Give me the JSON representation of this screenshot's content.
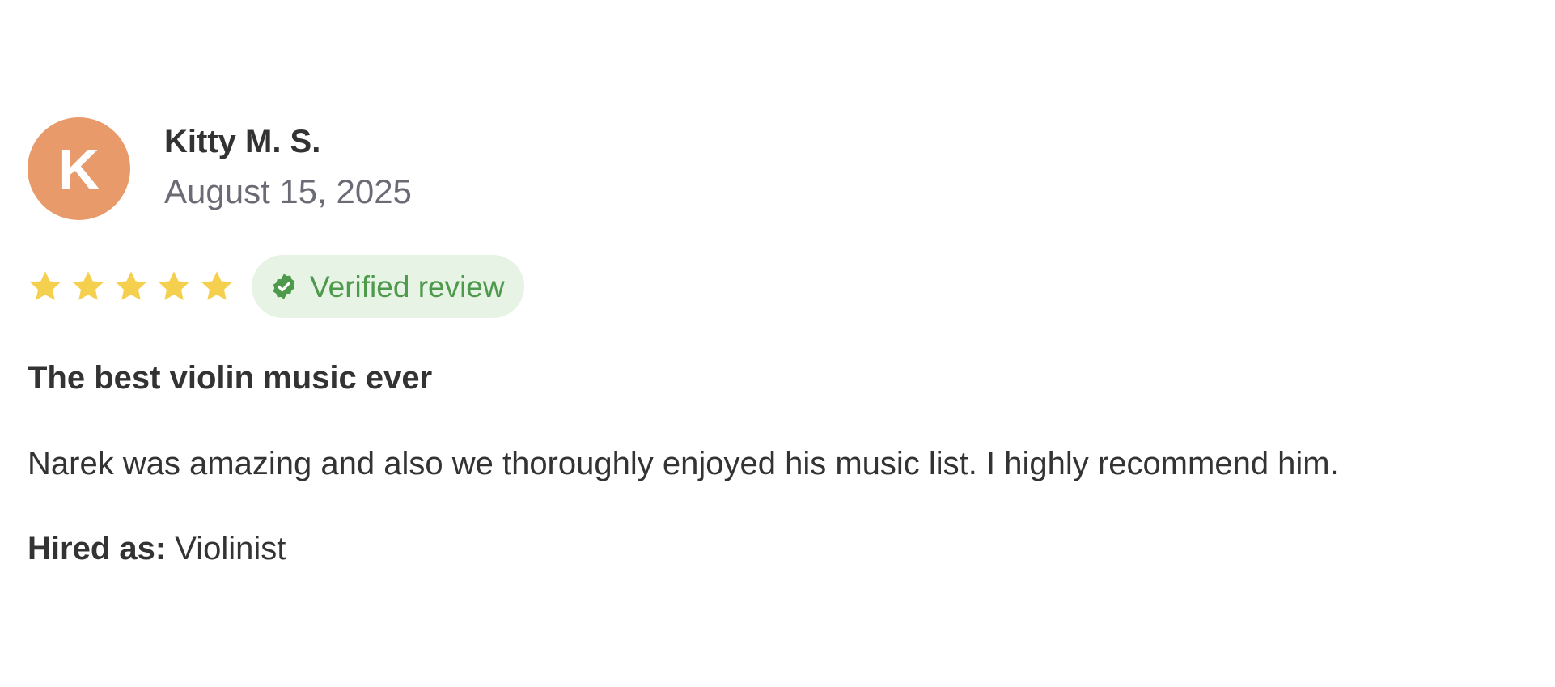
{
  "review": {
    "avatar": {
      "initial": "K",
      "color": "#E89A6B"
    },
    "reviewer_name": "Kitty M. S.",
    "date": "August 15, 2025",
    "rating": {
      "value": 5,
      "max": 5,
      "star_color": "#F5D04F"
    },
    "verified_badge": {
      "label": "Verified review",
      "icon": "verified-check-icon",
      "text_color": "#4E9A4C",
      "background": "#E7F3E4"
    },
    "title": "The best violin music ever",
    "body": "Narek was amazing and also we thoroughly enjoyed his music list. I highly recommend him.",
    "hired_as": {
      "label": "Hired as:",
      "value": "Violinist"
    }
  }
}
